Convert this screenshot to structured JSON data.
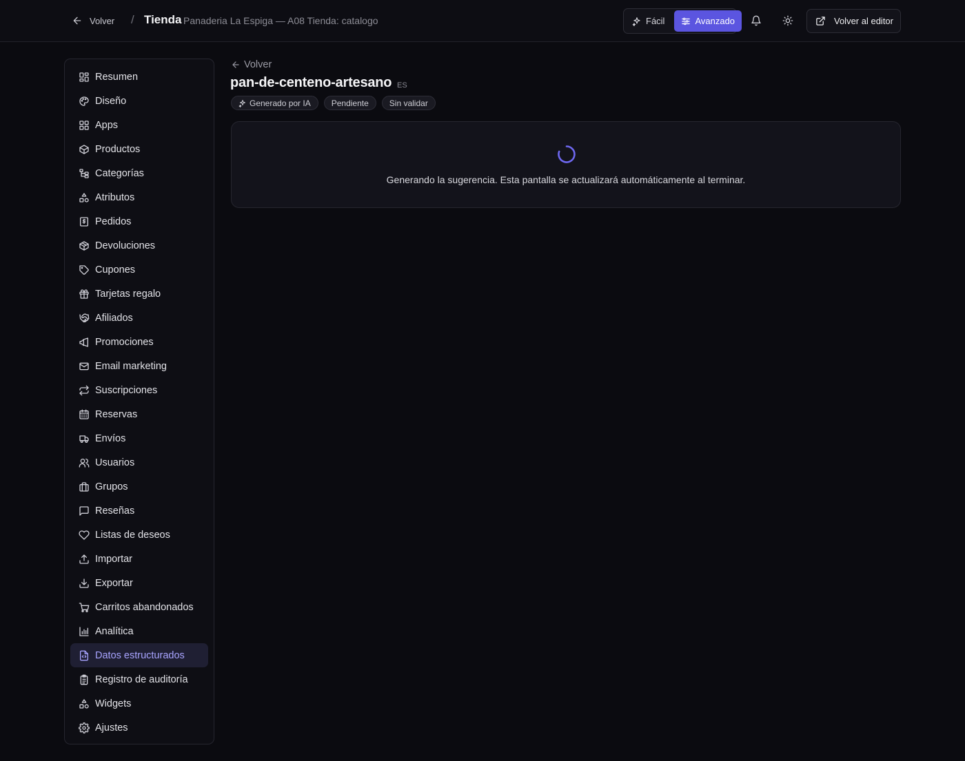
{
  "topbar": {
    "back_label": "Volver",
    "separator": "/",
    "title": "Tienda",
    "subtitle": "Panaderia La Espiga — A08 Tienda: catalogo",
    "modes": [
      {
        "label": "Fácil",
        "icon": "sparkles-icon",
        "active": false
      },
      {
        "label": "Avanzado",
        "icon": "sliders-icon",
        "active": true
      }
    ],
    "notifications_icon": "bell-icon",
    "theme_icon": "sun-icon",
    "editor_label": "Volver al editor",
    "editor_icon": "external-link-icon"
  },
  "sidebar": {
    "active_item": "Datos estructurados",
    "items": [
      {
        "label": "Resumen",
        "icon": "dashboard-icon"
      },
      {
        "label": "Diseño",
        "icon": "palette-icon"
      },
      {
        "label": "Apps",
        "icon": "apps-icon"
      },
      {
        "label": "Productos",
        "icon": "box-icon"
      },
      {
        "label": "Categorías",
        "icon": "tree-icon"
      },
      {
        "label": "Atributos",
        "icon": "shapes-icon"
      },
      {
        "label": "Pedidos",
        "icon": "receipt-icon"
      },
      {
        "label": "Devoluciones",
        "icon": "package-return-icon"
      },
      {
        "label": "Cupones",
        "icon": "tag-icon"
      },
      {
        "label": "Tarjetas regalo",
        "icon": "gift-icon"
      },
      {
        "label": "Afiliados",
        "icon": "handshake-icon"
      },
      {
        "label": "Promociones",
        "icon": "megaphone-icon"
      },
      {
        "label": "Email marketing",
        "icon": "mail-icon"
      },
      {
        "label": "Suscripciones",
        "icon": "repeat-icon"
      },
      {
        "label": "Reservas",
        "icon": "calendar-icon"
      },
      {
        "label": "Envíos",
        "icon": "truck-icon"
      },
      {
        "label": "Usuarios",
        "icon": "users-icon"
      },
      {
        "label": "Grupos",
        "icon": "briefcase-icon"
      },
      {
        "label": "Reseñas",
        "icon": "message-square-icon"
      },
      {
        "label": "Listas de deseos",
        "icon": "heart-icon"
      },
      {
        "label": "Importar",
        "icon": "upload-icon"
      },
      {
        "label": "Exportar",
        "icon": "download-icon"
      },
      {
        "label": "Carritos abandonados",
        "icon": "cart-icon"
      },
      {
        "label": "Analítica",
        "icon": "bar-chart-icon"
      },
      {
        "label": "Datos estructurados",
        "icon": "file-code-icon"
      },
      {
        "label": "Registro de auditoría",
        "icon": "clipboard-list-icon"
      },
      {
        "label": "Widgets",
        "icon": "shapes-icon"
      },
      {
        "label": "Ajustes",
        "icon": "gear-icon"
      }
    ]
  },
  "main": {
    "back_label": "Volver",
    "title": "pan-de-centeno-artesano",
    "lang": "ES",
    "badges": [
      {
        "label": "Generado por IA",
        "icon": "sparkles-icon"
      },
      {
        "label": "Pendiente"
      },
      {
        "label": "Sin validar"
      }
    ],
    "status_message": "Generando la sugerencia. Esta pantalla se actualizará automáticamente al terminar."
  },
  "colors": {
    "accent": "#5b55e0",
    "accent_text": "#a8a4ff",
    "background": "#0b0b10"
  }
}
